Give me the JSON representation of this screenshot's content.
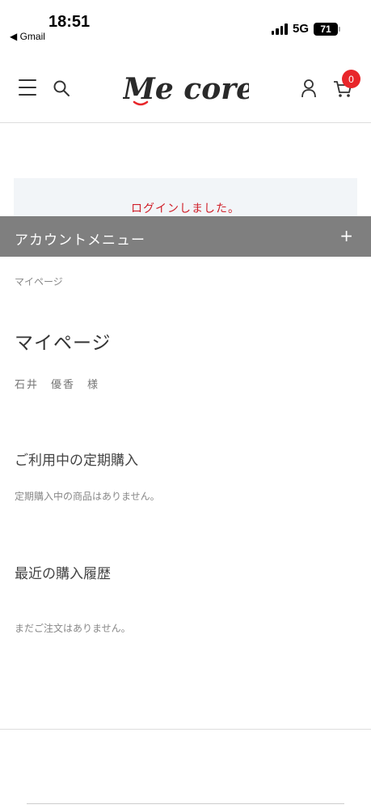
{
  "status_bar": {
    "time": "18:51",
    "back_app": "◀ Gmail",
    "network": "5G",
    "battery": "71"
  },
  "header": {
    "logo_text": "Me core",
    "cart_count": "0"
  },
  "notice": {
    "message": "ログインしました。"
  },
  "account_menu": {
    "title": "アカウントメニュー",
    "toggle": "+"
  },
  "breadcrumb": "マイページ",
  "page_title": "マイページ",
  "user_name": "石井　優香　様",
  "subscriptions": {
    "title": "ご利用中の定期購入",
    "empty_text": "定期購入中の商品はありません。"
  },
  "orders": {
    "title": "最近の購入履歴",
    "empty_text": "まだご注文はありません。"
  },
  "colors": {
    "accent_red": "#e8262a",
    "notice_red": "#d0202a",
    "menu_bar": "#7f7f7f"
  }
}
